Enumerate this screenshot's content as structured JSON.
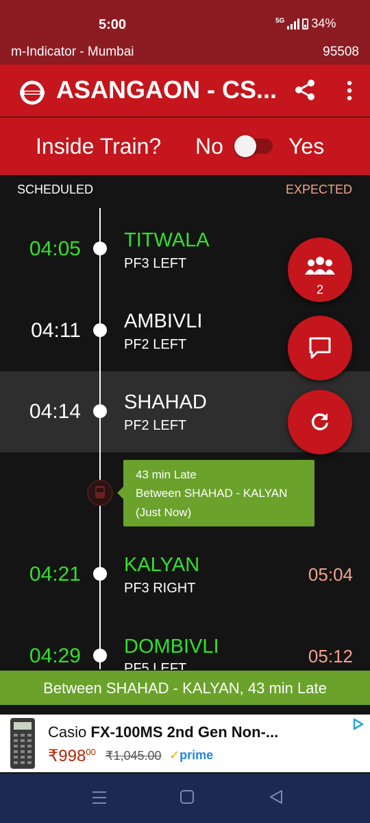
{
  "status_bar": {
    "time": "5:00",
    "network": "5G",
    "battery": "34%"
  },
  "app_header": {
    "name": "m-Indicator - Mumbai",
    "train_number": "95508"
  },
  "toolbar": {
    "title": "ASANGAON - CS...",
    "logo_icon": "railway-logo-icon",
    "share_icon": "share-icon",
    "menu_icon": "more-vert-icon"
  },
  "inside_train": {
    "question": "Inside Train?",
    "no_label": "No",
    "yes_label": "Yes",
    "value": false
  },
  "columns": {
    "scheduled": "SCHEDULED",
    "expected": "EXPECTED"
  },
  "stations": [
    {
      "time": "04:05",
      "name": "TITWALA",
      "platform": "PF3 LEFT",
      "expected": "",
      "passed": true
    },
    {
      "time": "04:11",
      "name": "AMBIVLI",
      "platform": "PF2 LEFT",
      "expected": "",
      "passed": false
    },
    {
      "time": "04:14",
      "name": "SHAHAD",
      "platform": "PF2 LEFT",
      "expected": "",
      "passed": false,
      "highlighted": true
    },
    {
      "time": "04:21",
      "name": "KALYAN",
      "platform": "PF3 RIGHT",
      "expected": "05:04",
      "passed": true
    },
    {
      "time": "04:29",
      "name": "DOMBIVLI",
      "platform": "PF5 LEFT",
      "expected": "05:12",
      "passed": true
    }
  ],
  "live_status": {
    "delay": "43 min Late",
    "location": "Between SHAHAD - KALYAN",
    "updated": "(Just Now)",
    "summary": "Between SHAHAD - KALYAN, 43 min Late"
  },
  "fabs": {
    "group_count": "2",
    "group_icon": "group-icon",
    "chat_icon": "chat-icon",
    "refresh_icon": "refresh-icon"
  },
  "ad": {
    "brand": "Casio",
    "product": "FX-100MS 2nd Gen Non-...",
    "price": "₹998",
    "price_paise": "00",
    "mrp": "₹1,045.00",
    "badge": "prime"
  },
  "colors": {
    "brand_red": "#c4161c",
    "status_dark_red": "#8d1b22",
    "green": "#33e02a",
    "live_green": "#6aa22b",
    "expected_salmon": "#f4a38d",
    "nav_blue": "#1c2a52"
  }
}
